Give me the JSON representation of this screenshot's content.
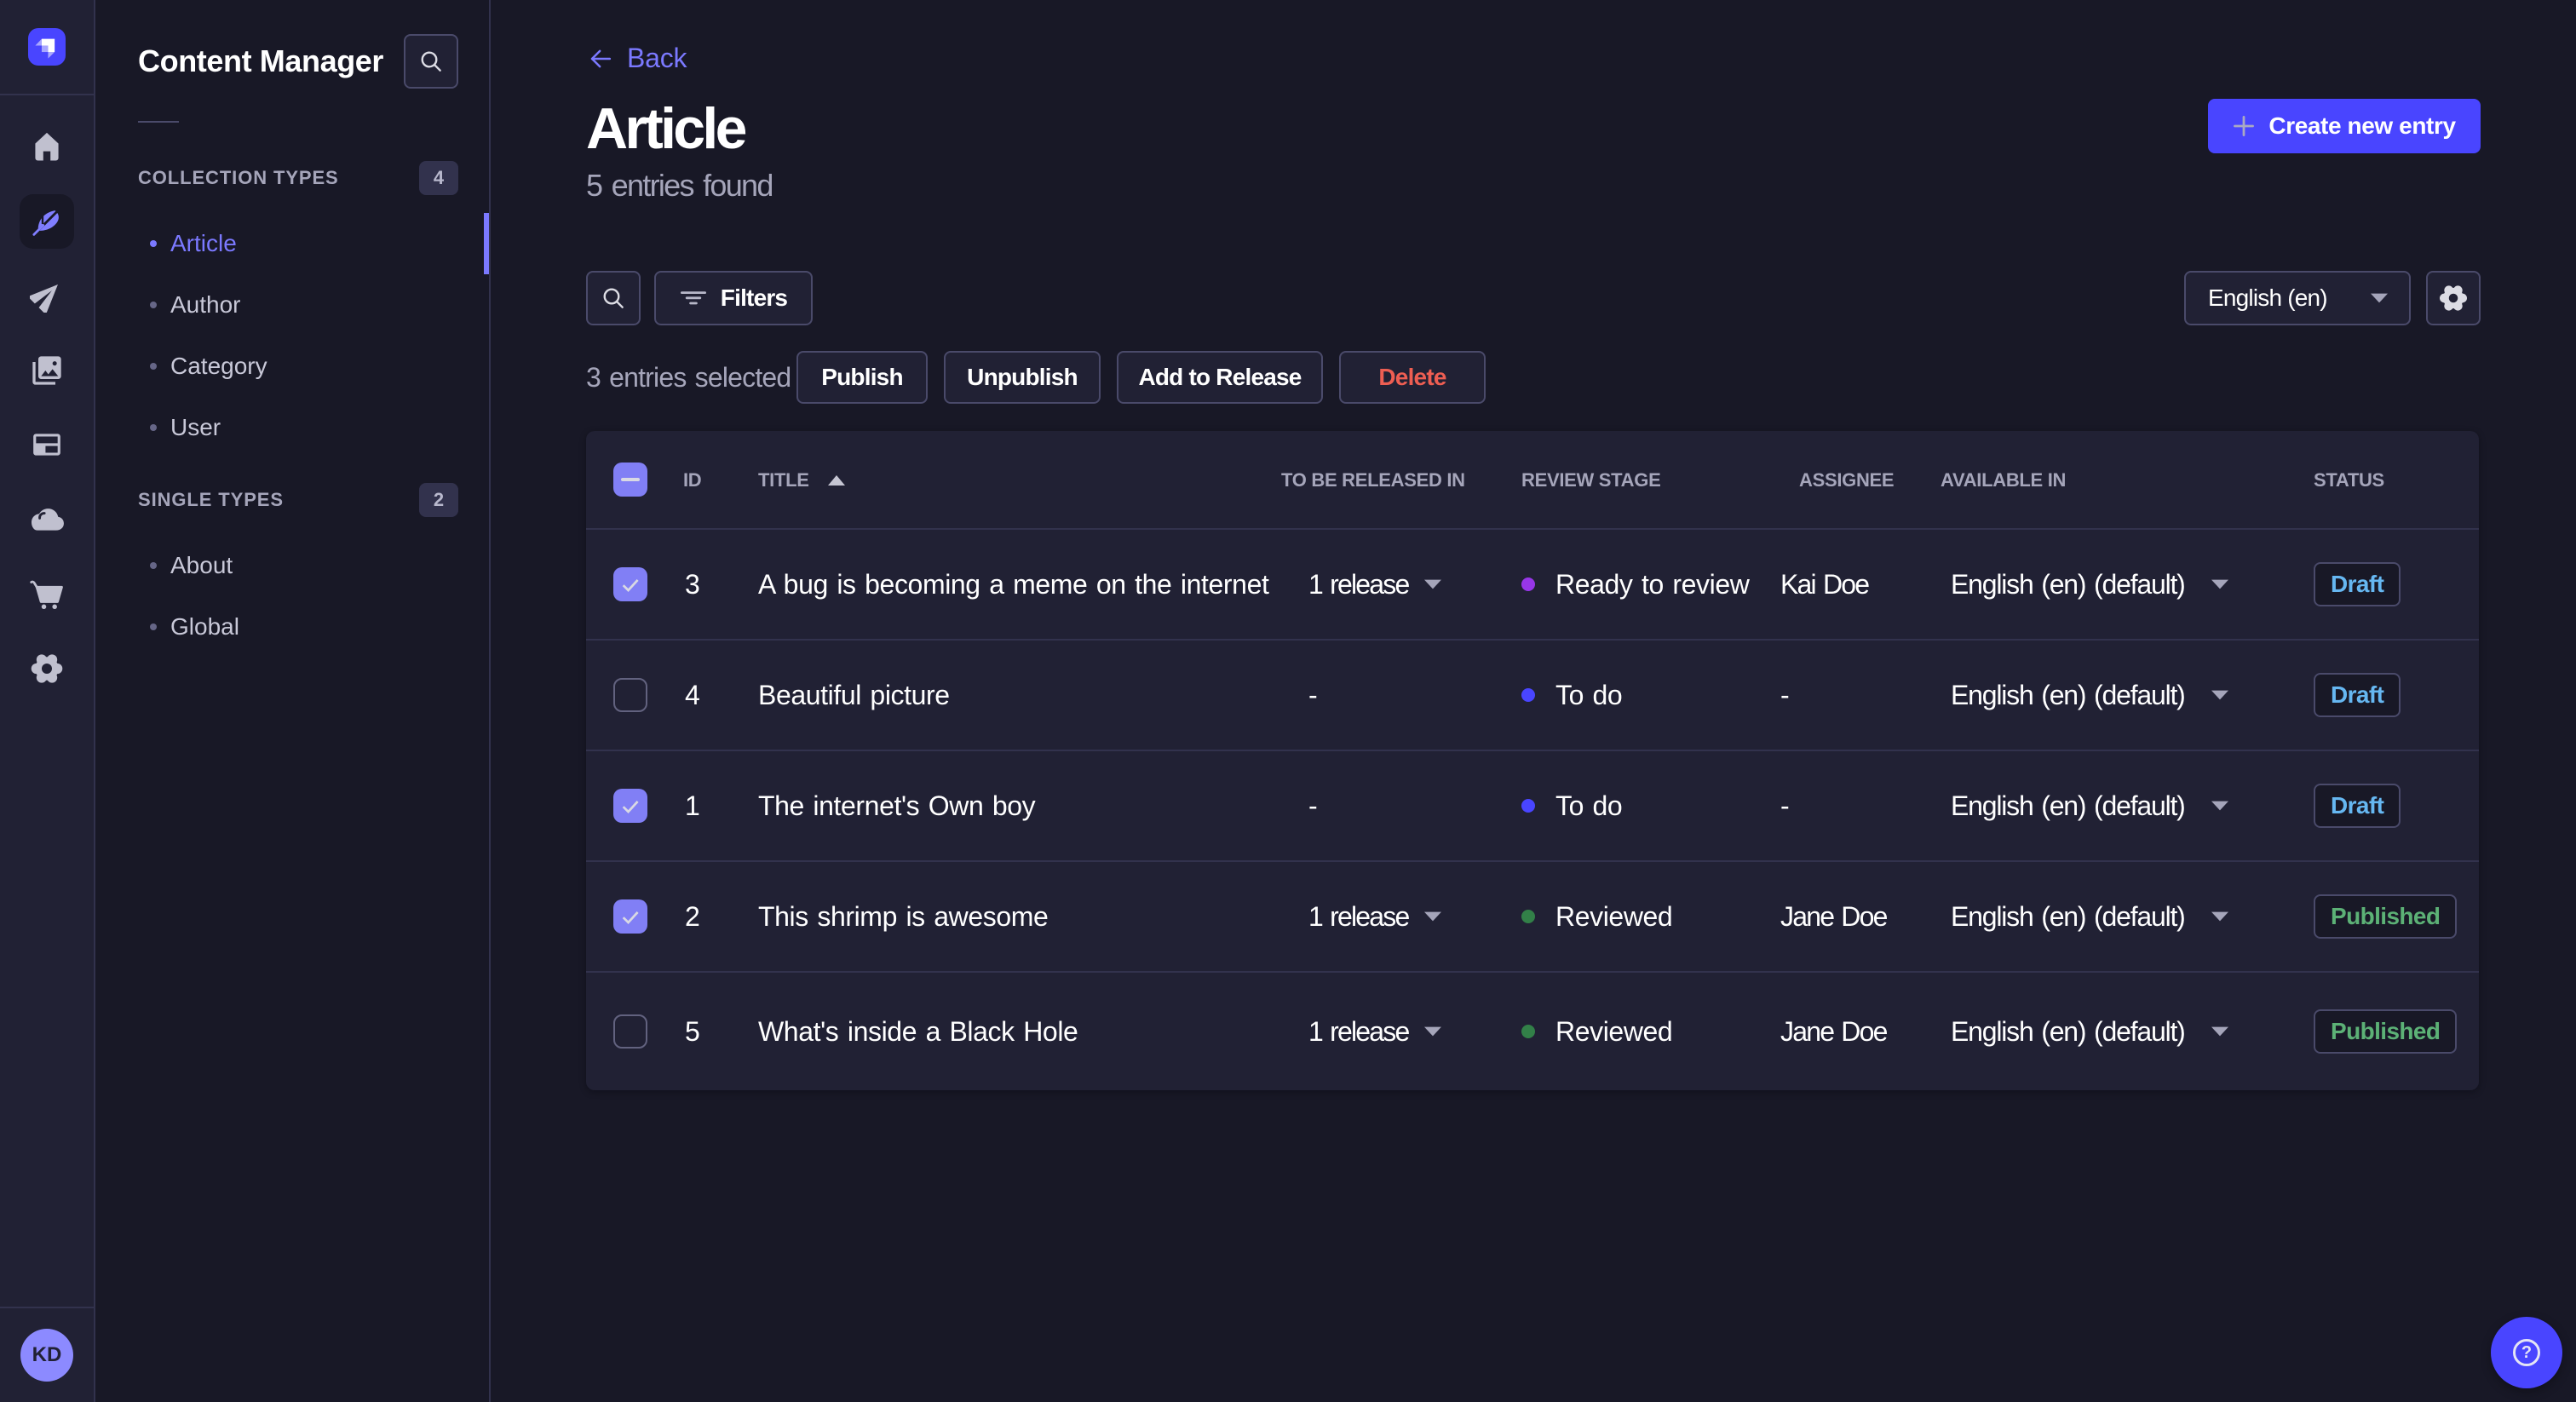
{
  "colors": {
    "background": "#181826",
    "panel": "#212134",
    "accent": "#4945ff",
    "accent_light": "#7b79ff",
    "danger": "#ee5e52",
    "draft_blue": "#66b7f1",
    "published_green": "#5cb176",
    "dot_ready": "#9736e8",
    "dot_todo": "#4945ff",
    "dot_reviewed": "#328048"
  },
  "rail": {
    "logo": "strapi-logo",
    "icons": [
      "home",
      "feather",
      "send",
      "images",
      "layout",
      "cloud",
      "cart",
      "gear"
    ],
    "active_icon": "feather",
    "avatar_initials": "KD"
  },
  "subnav": {
    "title": "Content Manager",
    "sections": [
      {
        "label": "COLLECTION TYPES",
        "badge": "4",
        "items": [
          {
            "label": "Article",
            "active": true
          },
          {
            "label": "Author",
            "active": false
          },
          {
            "label": "Category",
            "active": false
          },
          {
            "label": "User",
            "active": false
          }
        ]
      },
      {
        "label": "SINGLE TYPES",
        "badge": "2",
        "items": [
          {
            "label": "About",
            "active": false
          },
          {
            "label": "Global",
            "active": false
          }
        ]
      }
    ]
  },
  "header": {
    "back_label": "Back",
    "title": "Article",
    "subtitle": "5 entries found",
    "create_label": "Create new entry"
  },
  "toolbar": {
    "filters_label": "Filters",
    "locale_value": "English (en)",
    "selected_label": "3 entries selected",
    "publish_label": "Publish",
    "unpublish_label": "Unpublish",
    "add_release_label": "Add to Release",
    "delete_label": "Delete"
  },
  "table": {
    "headers": {
      "id": "ID",
      "title": "TITLE",
      "released": "TO BE RELEASED IN",
      "review": "REVIEW STAGE",
      "assignee": "ASSIGNEE",
      "available": "AVAILABLE IN",
      "status": "STATUS"
    },
    "select_all_state": "indeterminate",
    "rows": [
      {
        "checked": true,
        "id": "3",
        "title": "A bug is becoming a meme on the internet",
        "released": "1 release",
        "review": "Ready to review",
        "review_color": "#9736e8",
        "assignee": "Kai Doe",
        "available": "English (en) (default)",
        "status": "Draft"
      },
      {
        "checked": false,
        "id": "4",
        "title": "Beautiful picture",
        "released": "-",
        "review": "To do",
        "review_color": "#4945ff",
        "assignee": "-",
        "available": "English (en) (default)",
        "status": "Draft"
      },
      {
        "checked": true,
        "id": "1",
        "title": "The internet's Own boy",
        "released": "-",
        "review": "To do",
        "review_color": "#4945ff",
        "assignee": "-",
        "available": "English (en) (default)",
        "status": "Draft"
      },
      {
        "checked": true,
        "id": "2",
        "title": "This shrimp is awesome",
        "released": "1 release",
        "review": "Reviewed",
        "review_color": "#328048",
        "assignee": "Jane Doe",
        "available": "English (en) (default)",
        "status": "Published"
      },
      {
        "checked": false,
        "id": "5",
        "title": "What's inside a Black Hole",
        "released": "1 release",
        "review": "Reviewed",
        "review_color": "#328048",
        "assignee": "Jane Doe",
        "available": "English (en) (default)",
        "status": "Published"
      }
    ]
  },
  "help": {
    "icon": "question-mark"
  }
}
